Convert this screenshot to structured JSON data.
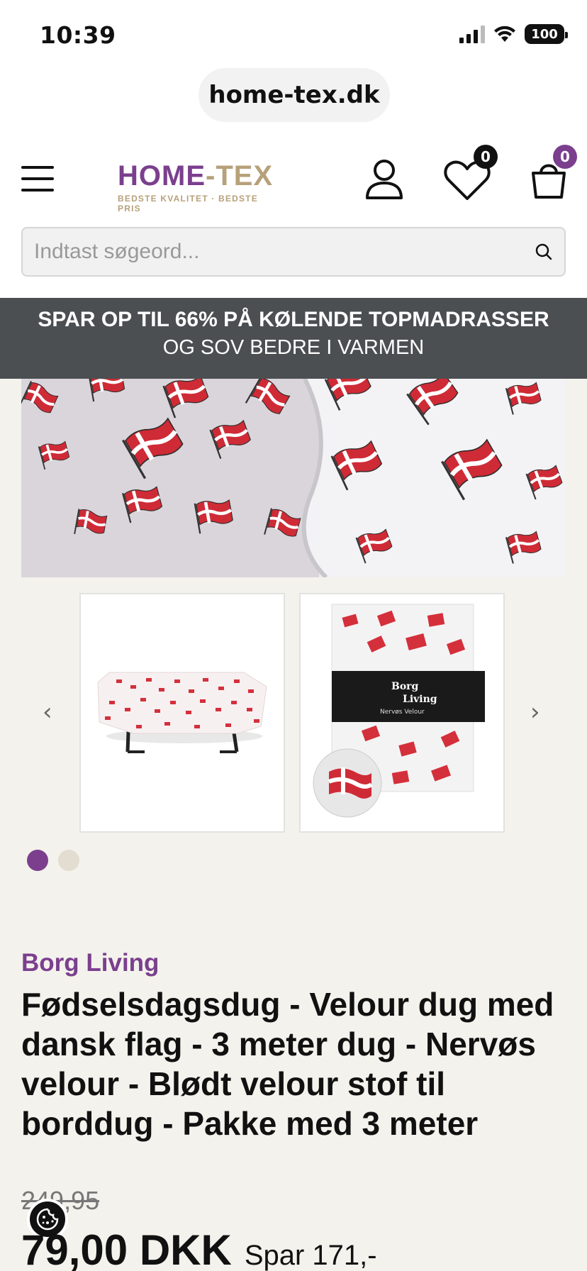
{
  "status_bar": {
    "time": "10:39",
    "battery": "100"
  },
  "browser": {
    "url": "home-tex.dk"
  },
  "header": {
    "logo_main_left": "HOME",
    "logo_main_dash": "-",
    "logo_main_right": "TEX",
    "logo_tagline": "BEDSTE KVALITET · BEDSTE PRIS",
    "wishlist_count": "0",
    "cart_count": "0",
    "search_placeholder": "Indtast søgeord..."
  },
  "promo": {
    "line1": "SPAR OP TIL 66% PÅ KØLENDE TOPMADRASSER",
    "line2": "OG SOV BEDRE I VARMEN"
  },
  "gallery": {
    "prev_arrow": "‹",
    "next_arrow": "›",
    "package_brand_line1": "Borg",
    "package_brand_line2": "Living",
    "package_product": "Nervøs Velour",
    "active_index": 0,
    "dot_count": 2
  },
  "product": {
    "brand": "Borg Living",
    "title": "Fødselsdagsdug - Velour dug med dansk flag - 3 meter dug - Nervøs velour - Blødt velour stof til borddug - Pakke med 3 meter",
    "old_price": "249,95",
    "price": "79,00 DKK",
    "saving": "Spar 171,-"
  },
  "colors": {
    "brand_purple": "#7b3f8e",
    "logo_gold": "#b7a17a",
    "promo_bg": "#4b4f52",
    "page_bg": "#f3f2ec",
    "flag_red": "#d8232f"
  }
}
